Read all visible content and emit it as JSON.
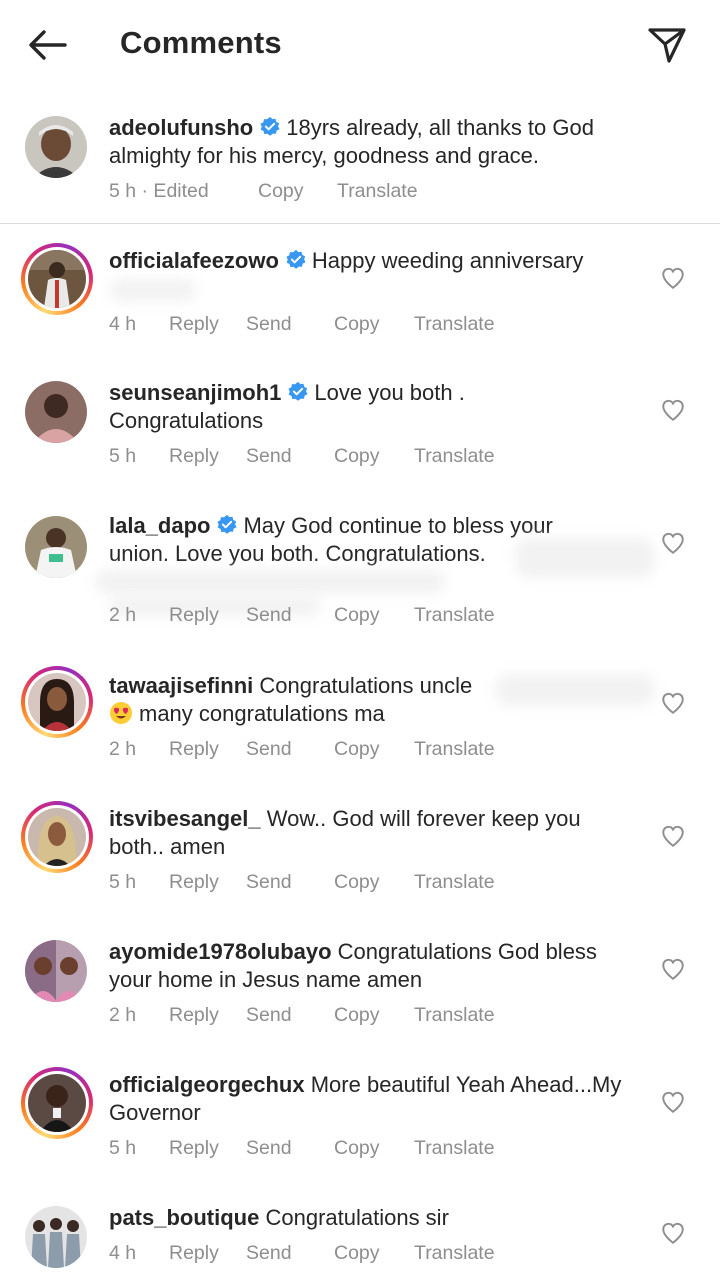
{
  "header": {
    "title": "Comments",
    "back_icon": "back-arrow-icon",
    "share_icon": "paper-plane-icon"
  },
  "caption": {
    "username": "adeolufunsho",
    "verified": true,
    "text_line1": "18yrs already, all thanks to God",
    "text_line2": "almighty for his mercy, goodness and grace.",
    "time": "5 h · Edited",
    "copy": "Copy",
    "translate": "Translate"
  },
  "actions": {
    "reply": "Reply",
    "send": "Send",
    "copy": "Copy",
    "translate": "Translate"
  },
  "comments": [
    {
      "username": "officialafeezowo",
      "verified": true,
      "line1": "Happy weeding anniversary",
      "line2": "",
      "time": "4 h"
    },
    {
      "username": "seunseanjimoh1",
      "verified": true,
      "line1": "Love you both .",
      "line2": "Congratulations",
      "time": "5 h"
    },
    {
      "username": "lala_dapo",
      "verified": true,
      "line1": "May God continue to bless your",
      "line2": "union. Love you both. Congratulations.",
      "time": "2 h"
    },
    {
      "username": "tawaajisefinni",
      "verified": false,
      "line1": "Congratulations uncle",
      "line2": "many congratulations ma",
      "emoji": "heart-eyes-emoji",
      "time": "2 h"
    },
    {
      "username": "itsvibesangel_",
      "verified": false,
      "line1": "Wow.. God will forever keep you",
      "line2": "both.. amen",
      "time": "5 h"
    },
    {
      "username": "ayomide1978olubayo",
      "verified": false,
      "line1": "Congratulations God bless",
      "line2": "your home in Jesus name amen",
      "time": "2 h"
    },
    {
      "username": "officialgeorgechux",
      "verified": false,
      "line1": "More beautiful Yeah Ahead...My",
      "line2": "Governor",
      "time": "5 h"
    },
    {
      "username": "pats_boutique",
      "verified": false,
      "line1": "Congratulations sir",
      "line2": "",
      "time": "4 h"
    }
  ],
  "colors": {
    "text": "#262626",
    "secondary": "#8e8e8e",
    "verified": "#3897f0",
    "divider": "#dbdbdb"
  }
}
